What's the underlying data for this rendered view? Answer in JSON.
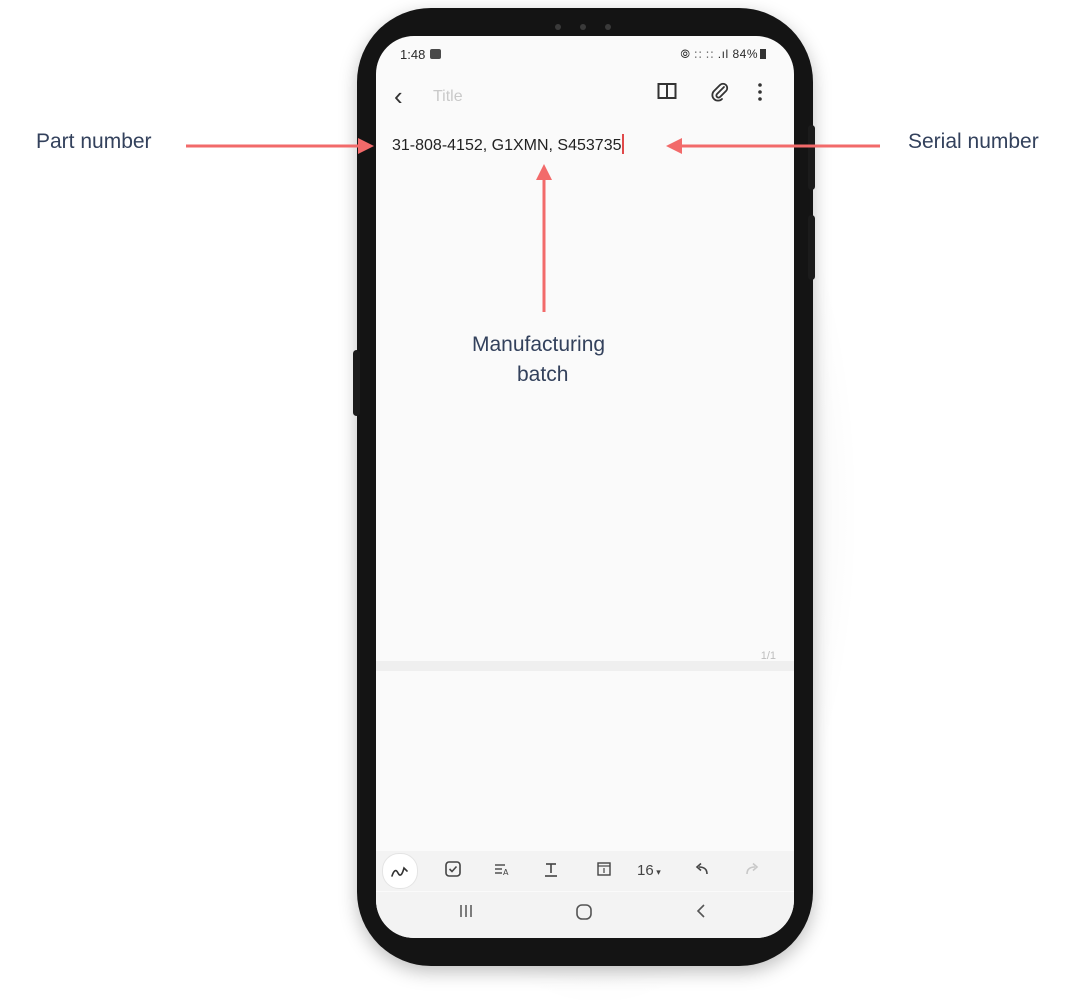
{
  "annotations": {
    "part_number": "Part number",
    "serial_number": "Serial number",
    "manufacturing_batch_line1": "Manufacturing",
    "manufacturing_batch_line2": "batch"
  },
  "colors": {
    "arrow": "#f26a6a",
    "annotation_text": "#33415c",
    "caret": "#e0494a"
  },
  "statusbar": {
    "time": "1:48",
    "icons_text": "☉ VoLTE 4G .┃ 84%",
    "battery_percent": "84%"
  },
  "toolbar": {
    "back_icon": "chevron-left-icon",
    "title_placeholder": "Title",
    "book_icon": "book-icon",
    "attach_icon": "paperclip-icon",
    "more_icon": "more-vertical-icon"
  },
  "note": {
    "body_text": "31-808-4152, G1XMN, S453735",
    "page_indicator": "1/1"
  },
  "format_bar": {
    "font_size": "16"
  },
  "navbar": {
    "recents_icon": "recents-icon",
    "home_icon": "home-icon",
    "back_icon": "back-icon"
  }
}
